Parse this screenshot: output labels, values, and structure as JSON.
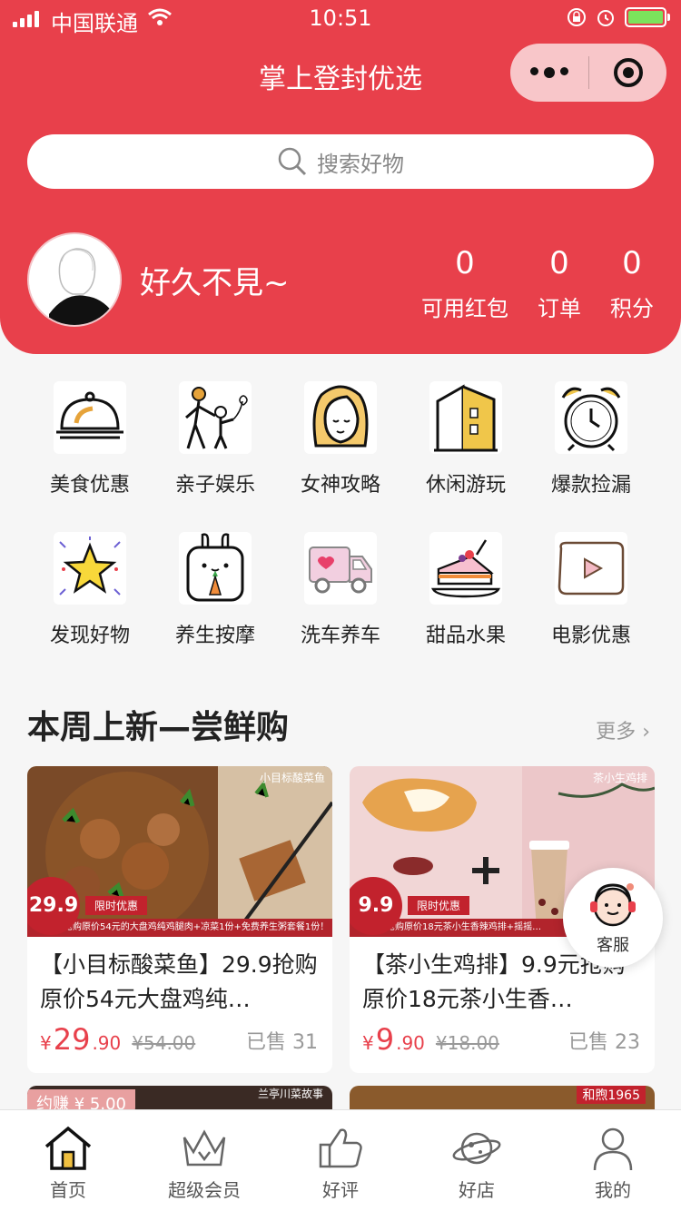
{
  "status": {
    "carrier": "中国联通",
    "time": "10:51"
  },
  "nav": {
    "title": "掌上登封优选"
  },
  "search": {
    "placeholder": "搜索好物"
  },
  "profile": {
    "greeting": "好久不見~"
  },
  "stats": [
    {
      "value": "0",
      "label": "可用红包"
    },
    {
      "value": "0",
      "label": "订单"
    },
    {
      "value": "0",
      "label": "积分"
    }
  ],
  "categories": [
    {
      "label": "美食优惠",
      "icon": "food-cloche-icon"
    },
    {
      "label": "亲子娱乐",
      "icon": "parent-child-icon"
    },
    {
      "label": "女神攻略",
      "icon": "woman-face-icon"
    },
    {
      "label": "休闲游玩",
      "icon": "building-icon"
    },
    {
      "label": "爆款捡漏",
      "icon": "alarm-clock-icon"
    },
    {
      "label": "发现好物",
      "icon": "star-icon"
    },
    {
      "label": "养生按摩",
      "icon": "rabbit-icon"
    },
    {
      "label": "洗车养车",
      "icon": "truck-icon"
    },
    {
      "label": "甜品水果",
      "icon": "cake-icon"
    },
    {
      "label": "电影优惠",
      "icon": "play-icon"
    }
  ],
  "section": {
    "title": "本周上新—尝鲜购",
    "more": "更多"
  },
  "products": [
    {
      "name": "【小目标酸菜鱼】29.9抢购原价54元大盘鸡纯…",
      "price_symbol": "¥",
      "price_int": "29",
      "price_dec": ".90",
      "orig_price": "¥54.00",
      "sold": "已售 31",
      "img_tag": "小目标酸菜鱼",
      "badge_price": "29.9",
      "limit": "限时优惠",
      "strip": "抢购原价54元的大盘鸡纯鸡腿肉+凉菜1份+免费养生粥套餐1份！"
    },
    {
      "name": "【茶小生鸡排】9.9元抢购原价18元茶小生香…",
      "price_symbol": "¥",
      "price_int": "9",
      "price_dec": ".90",
      "orig_price": "¥18.00",
      "sold": "已售 23",
      "img_tag": "茶小生鸡排",
      "badge_price": "9.9",
      "limit": "限时优惠",
      "strip": "抢购原价18元茶小生香辣鸡排+摇摇…"
    }
  ],
  "next_cards": [
    {
      "earn": "约赚 ¥ 5.00",
      "tag": "兰亭川菜故事"
    },
    {
      "tag": "和煦1965"
    }
  ],
  "kefu": {
    "label": "客服"
  },
  "tabs": [
    {
      "label": "首页",
      "icon": "home-icon"
    },
    {
      "label": "超级会员",
      "icon": "crown-icon"
    },
    {
      "label": "好评",
      "icon": "thumbs-up-icon"
    },
    {
      "label": "好店",
      "icon": "planet-icon"
    },
    {
      "label": "我的",
      "icon": "user-icon"
    }
  ],
  "colors": {
    "brand": "#e8404b",
    "price": "#e8404b"
  }
}
